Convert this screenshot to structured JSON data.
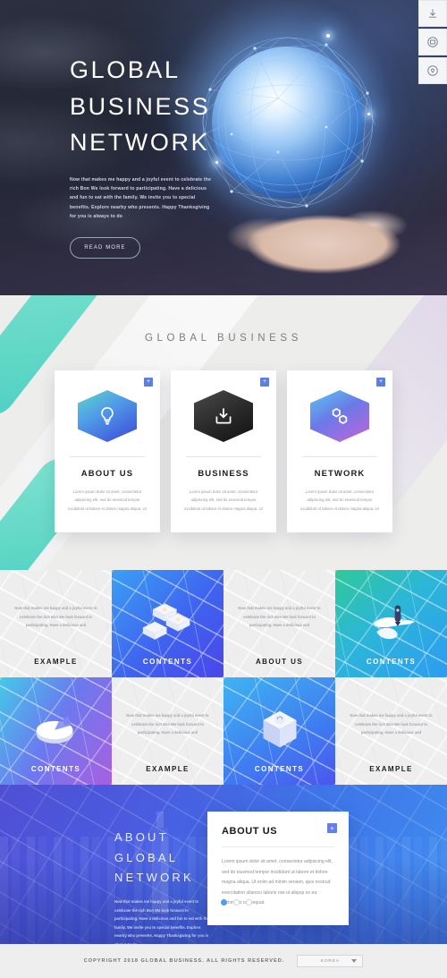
{
  "rail": {
    "items": [
      {
        "name": "download-icon",
        "label": "Download"
      },
      {
        "name": "chat-icon",
        "label": "Chat"
      },
      {
        "name": "location-pin-icon",
        "label": "Location"
      }
    ]
  },
  "hero": {
    "title_lines": [
      "GLOBAL",
      "BUSINESS",
      "NETWORK"
    ],
    "body": "Now that makes me happy and a joyful event to celebrate the rich Bon We look forward to participating. Have a delicious and fun to eat with the family. We invite you to special benefits. Explore nearby who presents. Happy Thanksgiving for you is always to do",
    "cta_label": "READ MORE"
  },
  "cards_section": {
    "heading": "GLOBAL BUSINESS",
    "plus_label": "+",
    "cards": [
      {
        "title": "ABOUT US",
        "icon": "lightbulb-icon",
        "text": "Lorem ipsum dolor sit amet, consectetur adipiscing elit, sed do eiusmod tempor incididunt ut labore et dolore magna aliqua. Ut"
      },
      {
        "title": "BUSINESS",
        "icon": "download-box-icon",
        "text": "Lorem ipsum dolor sit amet, consectetur adipiscing elit, sed do eiusmod tempor incididunt ut labore et dolore magna aliqua. Ut"
      },
      {
        "title": "NETWORK",
        "icon": "hexagons-icon",
        "text": "Lorem ipsum dolor sit amet, consectetur adipiscing elit, sed do eiusmod tempor incididunt ut labore et dolore magna aliqua. Ut"
      }
    ]
  },
  "grid_section": {
    "body_text": "Now that makes me happy and a joyful event to celebrate the rich Bon We look forward to participating. Have a delicious and",
    "cells": [
      {
        "label": "EXAMPLE",
        "style": "light",
        "art": "none"
      },
      {
        "label": "CONTENTS",
        "style": "dark",
        "art": "puzzle-pieces-icon"
      },
      {
        "label": "ABOUT US",
        "style": "light",
        "art": "none"
      },
      {
        "label": "CONTENTS",
        "style": "dark",
        "art": "rocket-island-icon"
      },
      {
        "label": "CONTENTS",
        "style": "dark",
        "art": "pie-chart-icon"
      },
      {
        "label": "EXAMPLE",
        "style": "light",
        "art": "none"
      },
      {
        "label": "CONTENTS",
        "style": "dark",
        "art": "cube-icon"
      },
      {
        "label": "EXAMPLE",
        "style": "light",
        "art": "none"
      }
    ]
  },
  "about_section": {
    "heading_lines": [
      "ABOUT",
      "GLOBAL",
      "NETWORK"
    ],
    "paragraph": "Now that makes me happy and a joyful event to celebrate the rich Bon We look forward to participating. Have a delicious and fun to eat with the family. We invite you to special benefits. Explore nearby who presents. Happy Thanksgiving for you is always to do",
    "card": {
      "title": "ABOUT US",
      "plus_label": "+",
      "text": "Lorem ipsum dolor sit amet, consectetur adipiscing elit, sed do eiusmod tempor incididunt ut labore et dolore magna aliqua. Ut enim ad minim veniam, quis nostrud exercitation ullamco laboris nisi ut aliquip ex ea commodo consequat."
    },
    "dots": {
      "count": 3,
      "active": 0
    }
  },
  "footer": {
    "copyright": "COPYRIGHT 2018 GLOBAL BUSINESS.  ALL RIGHTS RESERVED.",
    "language_selected": "KOREA"
  },
  "colors": {
    "accent_blue": "#4a9ff0",
    "accent_teal": "#4dd0c3",
    "plus_badge": "#5b7fe0",
    "dark_hero": "#2b3040"
  }
}
